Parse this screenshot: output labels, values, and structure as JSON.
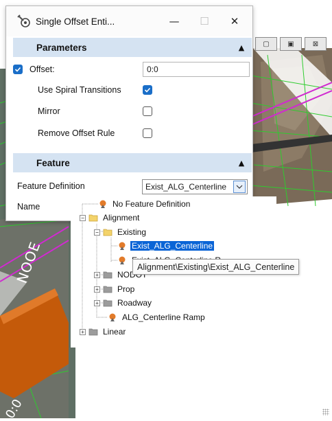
{
  "background_window": {
    "buttons": [
      {
        "icon": "restore-icon",
        "glyph": "▢"
      },
      {
        "icon": "maximize-icon",
        "glyph": "▣"
      },
      {
        "icon": "close-icon",
        "glyph": "⊠"
      }
    ],
    "map_labels": [
      "NOOE",
      "0:0"
    ]
  },
  "dialog": {
    "title": "Single Offset Enti...",
    "title_icon": "wrench-gear-icon",
    "controls": {
      "minimize": "—",
      "maximize": "☐",
      "close": "✕"
    },
    "parameters": {
      "header": "Parameters",
      "offset": {
        "checked": true,
        "label": "Offset:",
        "value": "0:0"
      },
      "use_spiral": {
        "label": "Use Spiral Transitions",
        "checked": true
      },
      "mirror": {
        "label": "Mirror",
        "checked": false
      },
      "remove_offset": {
        "label": "Remove Offset Rule",
        "checked": false
      }
    },
    "feature": {
      "header": "Feature",
      "definition_label": "Feature Definition",
      "definition_value": "Exist_ALG_Centerline",
      "name_label": "Name"
    }
  },
  "tree": {
    "items": [
      {
        "label": "No Feature Definition",
        "icon": "feature-icon",
        "expander": ""
      },
      {
        "label": "Alignment",
        "icon": "folder-open-icon",
        "expander": "−"
      },
      {
        "label": "Existing",
        "icon": "folder-open-icon",
        "expander": "−"
      },
      {
        "label": "Exist_ALG_Centerline",
        "icon": "feature-icon",
        "expander": "",
        "selected": true
      },
      {
        "label": "Exist_ALG_Centerline R",
        "icon": "feature-icon",
        "expander": ""
      },
      {
        "label": "NODOT",
        "icon": "folder-icon",
        "expander": "+"
      },
      {
        "label": "Prop",
        "icon": "folder-icon",
        "expander": "+"
      },
      {
        "label": "Roadway",
        "icon": "folder-icon",
        "expander": "+"
      },
      {
        "label": "ALG_Centerline Ramp",
        "icon": "feature-icon",
        "expander": ""
      },
      {
        "label": "Linear",
        "icon": "folder-icon",
        "expander": "+"
      }
    ]
  },
  "tooltip": "Alignment\\Existing\\Exist_ALG_Centerline",
  "colors": {
    "accent": "#1a6ec8",
    "section_header": "#d5e3f2",
    "selection": "#0a64d6",
    "map_green": "#2ecc2e",
    "map_magenta": "#d02ad0",
    "map_orange": "#c45a0a"
  }
}
